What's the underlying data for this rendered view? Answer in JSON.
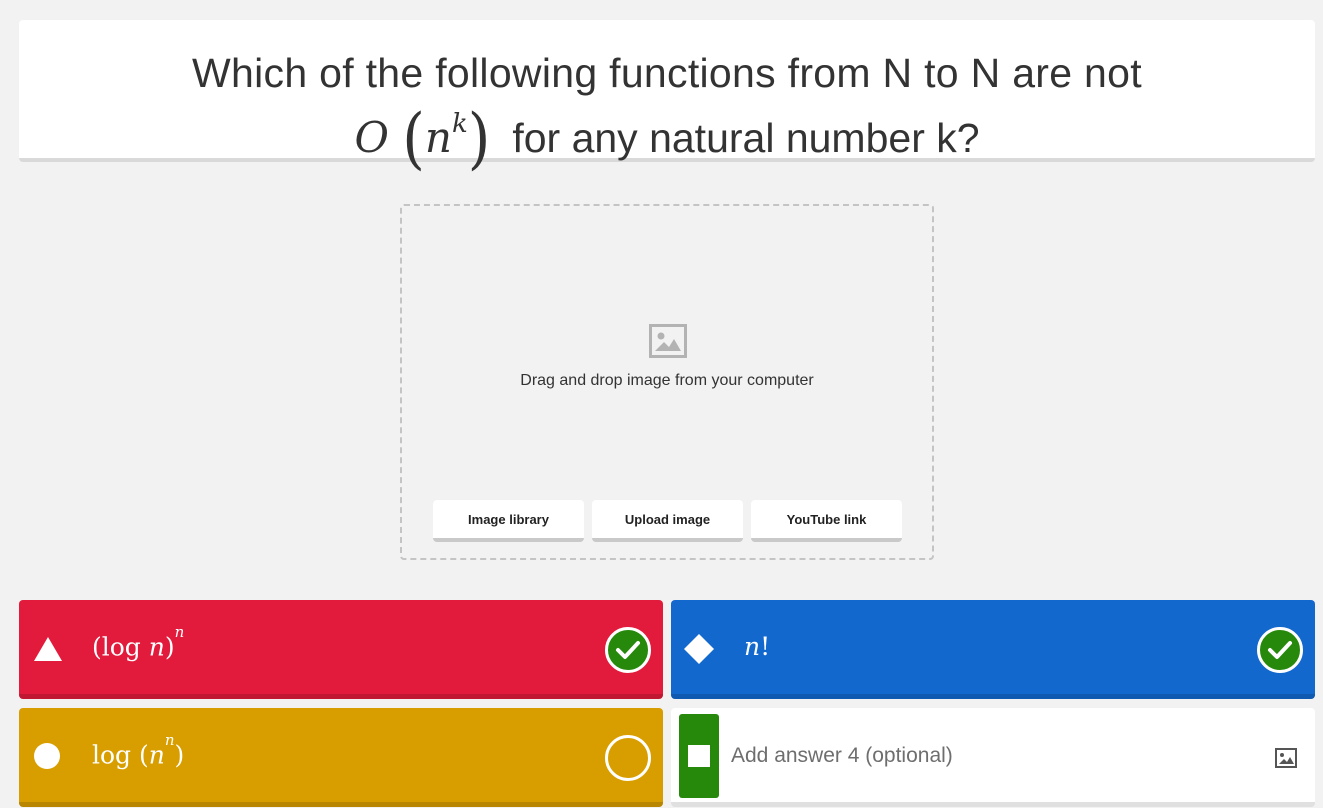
{
  "question": {
    "line1": "Which of the following functions from N to N are not",
    "math_O": "O",
    "math_paren_open": "(",
    "math_base": "n",
    "math_exp": "k",
    "math_paren_close": ")",
    "line2_text": "for any natural number k?"
  },
  "media": {
    "icon": "image-icon",
    "drop_text": "Drag and drop image from your computer",
    "buttons": [
      "Image library",
      "Upload image",
      "YouTube link"
    ]
  },
  "answers": [
    {
      "shape": "triangle",
      "color": "#e21b3c",
      "text_pre": "(log ",
      "text_var": "n",
      "text_post": ")",
      "sup": "n",
      "correct": true
    },
    {
      "shape": "diamond",
      "color": "#1368ce",
      "text_var": "n",
      "text_post": "!",
      "correct": true
    },
    {
      "shape": "circle",
      "color": "#d89e00",
      "text_pre": "log (",
      "text_var": "n",
      "sup": "n",
      "text_post": ")",
      "correct": false
    },
    {
      "shape": "square",
      "color": "#26890c",
      "placeholder": "Add answer 4 (optional)",
      "icon": "image-icon"
    }
  ]
}
